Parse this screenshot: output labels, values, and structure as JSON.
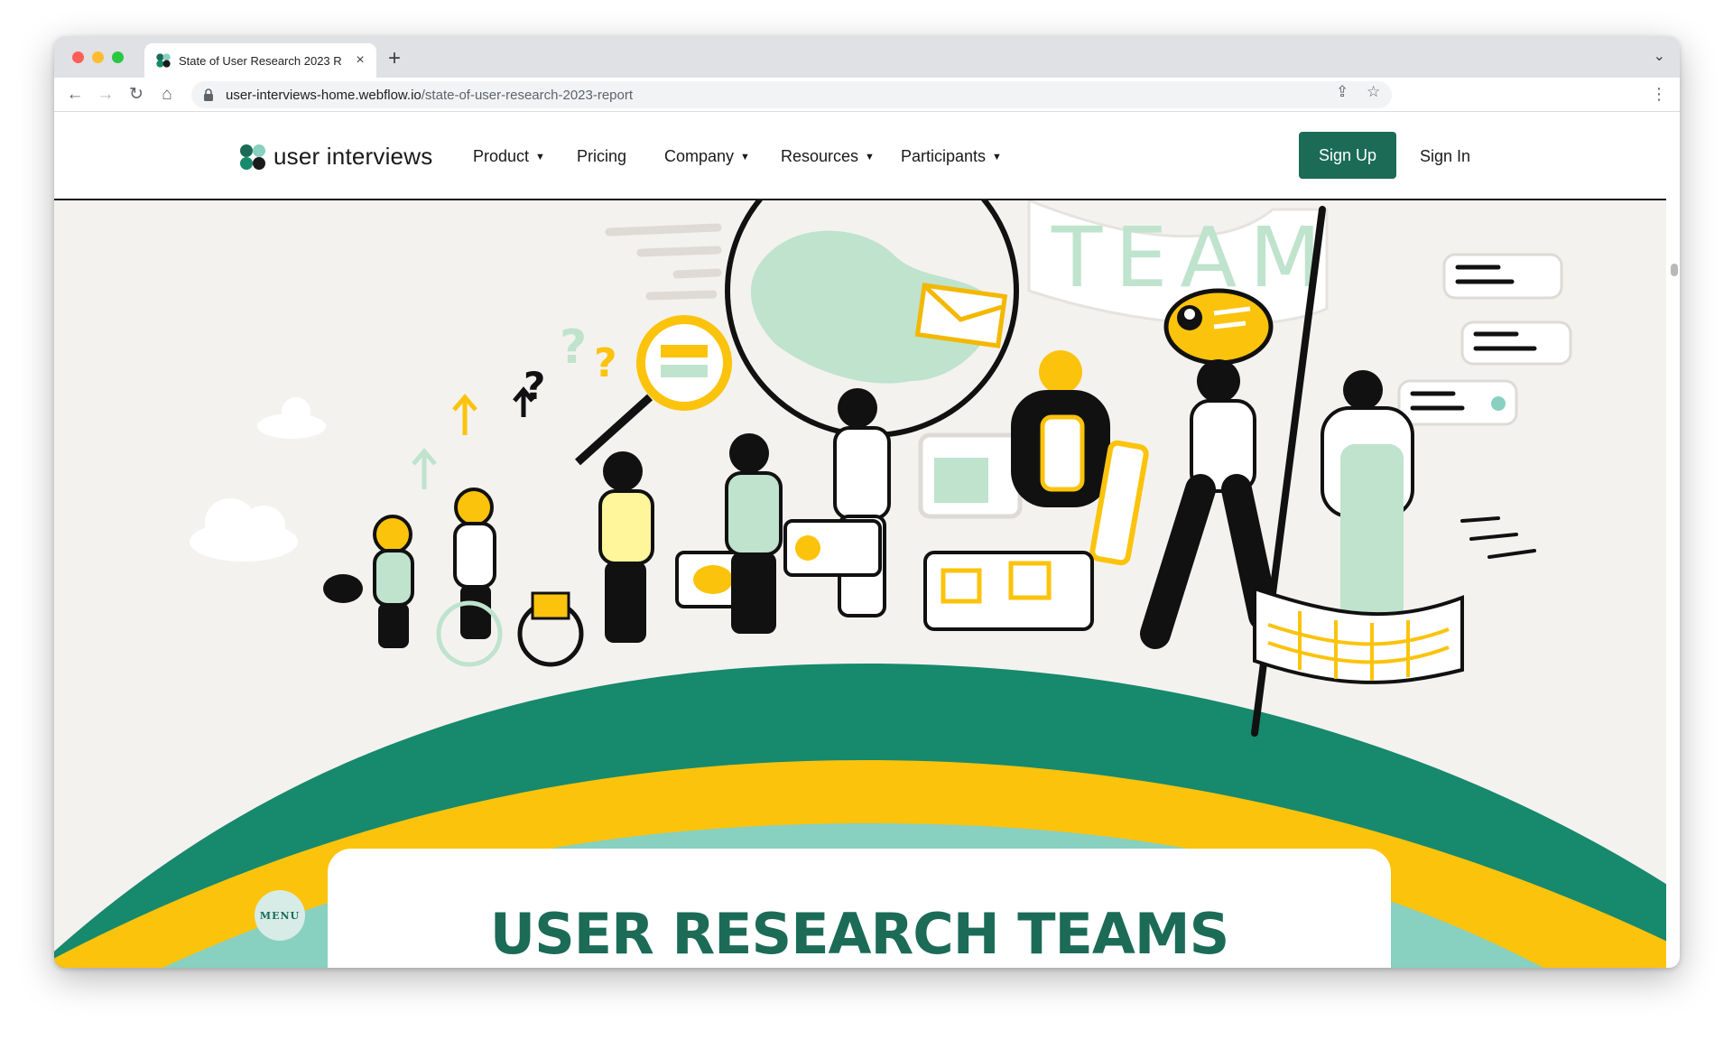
{
  "browser": {
    "tab_title": "State of User Research 2023 R",
    "url_host": "user-interviews-home.webflow.io",
    "url_path": "/state-of-user-research-2023-report",
    "new_tab_label": "+",
    "close_label": "×"
  },
  "site": {
    "logo_text": "user interviews",
    "nav": {
      "product": "Product",
      "pricing": "Pricing",
      "company": "Company",
      "resources": "Resources",
      "participants": "Participants"
    },
    "signup_label": "Sign Up",
    "signin_label": "Sign In"
  },
  "hero": {
    "illustration_banner_text": "TEAM",
    "title": "USER RESEARCH TEAMS",
    "menu_label": "MENU"
  },
  "colors": {
    "brand_green": "#1b6b57",
    "rainbow_green": "#17896d",
    "rainbow_yellow": "#fbc30c",
    "rainbow_mint": "#88d0c0",
    "background": "#f4f2ef"
  }
}
